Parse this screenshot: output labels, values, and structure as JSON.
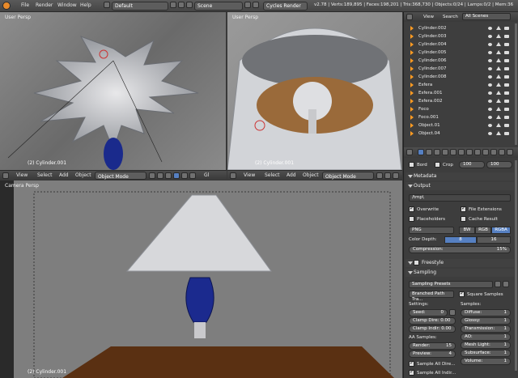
{
  "topbar": {
    "menus": [
      "File",
      "Render",
      "Window",
      "Help"
    ],
    "layout": "Default",
    "scene": "Scene",
    "engine": "Cycles Render",
    "stats": "v2.78 | Verts:189,895 | Faces:198,201 | Tris:368,730 | Objects:0/24 | Lamps:0/2 | Mem:36"
  },
  "viewport_tl": {
    "label": "User Persp",
    "object": "(2) Cylinder.001"
  },
  "viewport_tr": {
    "label": "User Persp",
    "object": "(2) Cylinder.001"
  },
  "viewport_bottom": {
    "label": "Camera Persp",
    "object": "(2) Cylinder.001"
  },
  "header": {
    "view": "View",
    "select": "Select",
    "add": "Add",
    "object": "Object",
    "mode": "Object Mode",
    "global": "Gl"
  },
  "outliner": {
    "view": "View",
    "search": "Search",
    "scenes": "All Scenes",
    "items": [
      "Cylinder.002",
      "Cylinder.003",
      "Cylinder.004",
      "Cylinder.005",
      "Cylinder.006",
      "Cylinder.007",
      "Cylinder.008",
      "Esfera",
      "Esfera.001",
      "Esfera.002",
      "Foco",
      "Foco.001",
      "Object.01",
      "Object.04"
    ]
  },
  "props": {
    "border": "Bord",
    "crop": "Crop",
    "x": "100",
    "y": "100",
    "metadata": "Metadata",
    "output": "Output",
    "path": "/tmp\\",
    "overwrite": "Overwrite",
    "file_ext": "File Extensions",
    "placeholders": "Placeholders",
    "cache": "Cache Result",
    "format": "PNG",
    "bw": "BW",
    "rgb": "RGB",
    "rgba": "RGBA",
    "depth_label": "Color Depth:",
    "depth8": "8",
    "depth16": "16",
    "compression_label": "Compression:",
    "compression": "15%",
    "freestyle": "Freestyle",
    "sampling": "Sampling",
    "presets": "Sampling Presets",
    "integrator": "Branched Path Tra...",
    "square": "Square Samples",
    "settings": "Settings:",
    "samples": "Samples:",
    "seed_label": "Seed:",
    "seed": "0",
    "clamp_direct": "Clamp Dire: 0.00",
    "clamp_indirect": "Clamp Indir: 0.00",
    "aa": "AA Samples:",
    "render_label": "Render:",
    "render": "15",
    "preview_label": "Preview:",
    "preview": "4",
    "diffuse_label": "Diffuse:",
    "diffuse": "1",
    "glossy_label": "Glossy:",
    "glossy": "1",
    "trans_label": "Transmission:",
    "trans": "1",
    "ao_label": "AO:",
    "ao": "1",
    "mesh_label": "Mesh Light:",
    "mesh": "1",
    "sss_label": "Subsurface:",
    "sss": "1",
    "volume_label": "Volume:",
    "volume": "1",
    "all_direct": "Sample All Dire...",
    "all_indirect": "Sample All Indir..."
  },
  "colors": {
    "accent": "#5680c2",
    "orange": "#ff9b22"
  }
}
